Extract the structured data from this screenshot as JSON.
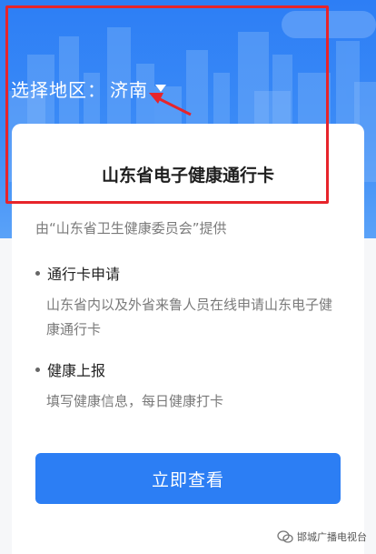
{
  "header": {
    "region_label": "选择地区：",
    "region_value": "济南"
  },
  "card": {
    "title": "山东省电子健康通行卡",
    "provider": "由“山东省卫生健康委员会”提供",
    "sections": [
      {
        "title": "通行卡申请",
        "desc": "山东省内以及外省来鲁人员在线申请山东电子健康通行卡"
      },
      {
        "title": "健康上报",
        "desc": "填写健康信息，每日健康打卡"
      }
    ],
    "button_label": "立即查看"
  },
  "watermark": {
    "text": "邯城广播电视台"
  },
  "colors": {
    "primary": "#2c7ef4",
    "annotation": "#e7242b"
  },
  "icons": {
    "caret": "caret-down-icon",
    "arrow": "red-arrow-icon",
    "wechat": "wechat-icon"
  }
}
